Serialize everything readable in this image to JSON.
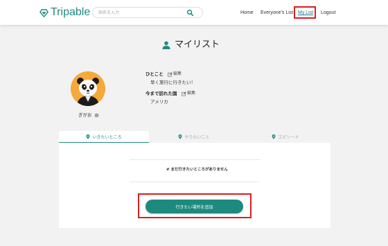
{
  "header": {
    "logo_text": "Tripable",
    "search_placeholder": "国名を入力",
    "nav": {
      "home": "Home",
      "everyone": "Everyone's List",
      "mylist": "My List",
      "logout": "Logout"
    }
  },
  "page": {
    "title": "マイリスト"
  },
  "profile": {
    "username": "ぎがお",
    "bio_label": "ひとこと",
    "bio_value": "早く旅行に行きたい！",
    "visited_label": "今まで訪れた国",
    "visited_value": "アメリカ",
    "edit_label": "編集"
  },
  "tabs": [
    {
      "label": "いきたいところ",
      "active": true
    },
    {
      "label": "やりたいこと",
      "active": false
    },
    {
      "label": "エピソード",
      "active": false
    }
  ],
  "content": {
    "empty_message": "# まだ行きたいところがありません",
    "add_button": "行きたい場所を追加"
  },
  "colors": {
    "brand": "#1e8a7e",
    "highlight": "#d81e1e",
    "avatar_bg": "#f5a93a"
  }
}
